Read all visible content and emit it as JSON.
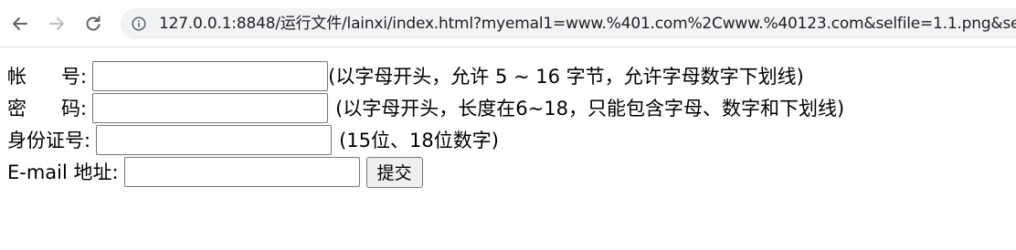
{
  "browser": {
    "url": "127.0.0.1:8848/运行文件/lainxi/index.html?myemal1=www.%401.com%2Cwww.%40123.com&selfile=1.1.png&sel"
  },
  "form": {
    "account": {
      "label_first": "帐",
      "label_second": "号:",
      "hint": "(以字母开头，允许 5 ~ 16 字节，允许字母数字下划线)"
    },
    "password": {
      "label_first": "密",
      "label_second": "码:",
      "hint": "(以字母开头，长度在6~18，只能包含字母、数字和下划线)"
    },
    "id_number": {
      "label": "身份证号:",
      "hint": "(15位、18位数字)"
    },
    "email": {
      "label": "E-mail 地址:",
      "submit_label": "提交"
    }
  }
}
